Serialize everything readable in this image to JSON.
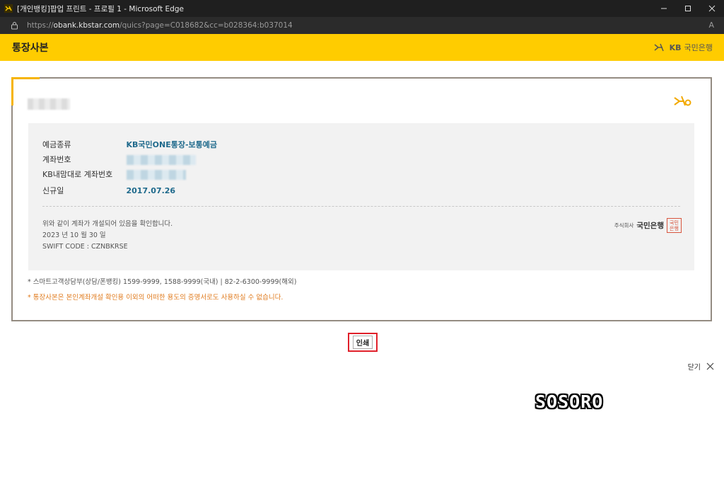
{
  "window": {
    "title": "[개인뱅킹]팝업 프린트 - 프로필 1 - Microsoft Edge",
    "controls": {
      "minimize_icon": "minimize-icon",
      "maximize_icon": "maximize-icon",
      "close_icon": "close-icon"
    }
  },
  "address_bar": {
    "url_prefix": "https://",
    "url_host": "obank.kbstar.com",
    "url_path": "/quics?page=C018682&cc=b028364:b037014",
    "read_aloud": "A"
  },
  "header": {
    "title": "통장사본",
    "brand_logo_text": "KB",
    "brand_name": "국민은행",
    "bg_color": "#ffcc00"
  },
  "certificate": {
    "account_type": {
      "label": "예금종류",
      "value": "KB국민ONE통장-보통예금"
    },
    "account_number": {
      "label": "계좌번호"
    },
    "nickname_account": {
      "label": "KB내맘대로 계좌번호"
    },
    "opened_date": {
      "label": "신규일",
      "value": "2017.07.26"
    },
    "confirm_text": "위와 같이 계좌가 개설되어 있음을 확인합니다.",
    "date_text": "2023 년 10 월 30 일",
    "swift_code": "SWIFT CODE : CZNBKRSE",
    "corp_prefix": "주식회사",
    "corp_name": "국민은행",
    "seal_text_top": "국민",
    "seal_text_bottom": "은행",
    "note_phone": "* 스마트고객상담부(상담/폰뱅킹) 1599-9999, 1588-9999(국내) | 82-2-6300-9999(해외)",
    "note_warning": "* 통장사본은 본인계좌개설 확인용 이외의 어떠한 용도의 증명서로도 사용하실 수 없습니다."
  },
  "actions": {
    "print_label": "인쇄",
    "close_label": "닫기"
  },
  "watermark": "SOSORO"
}
